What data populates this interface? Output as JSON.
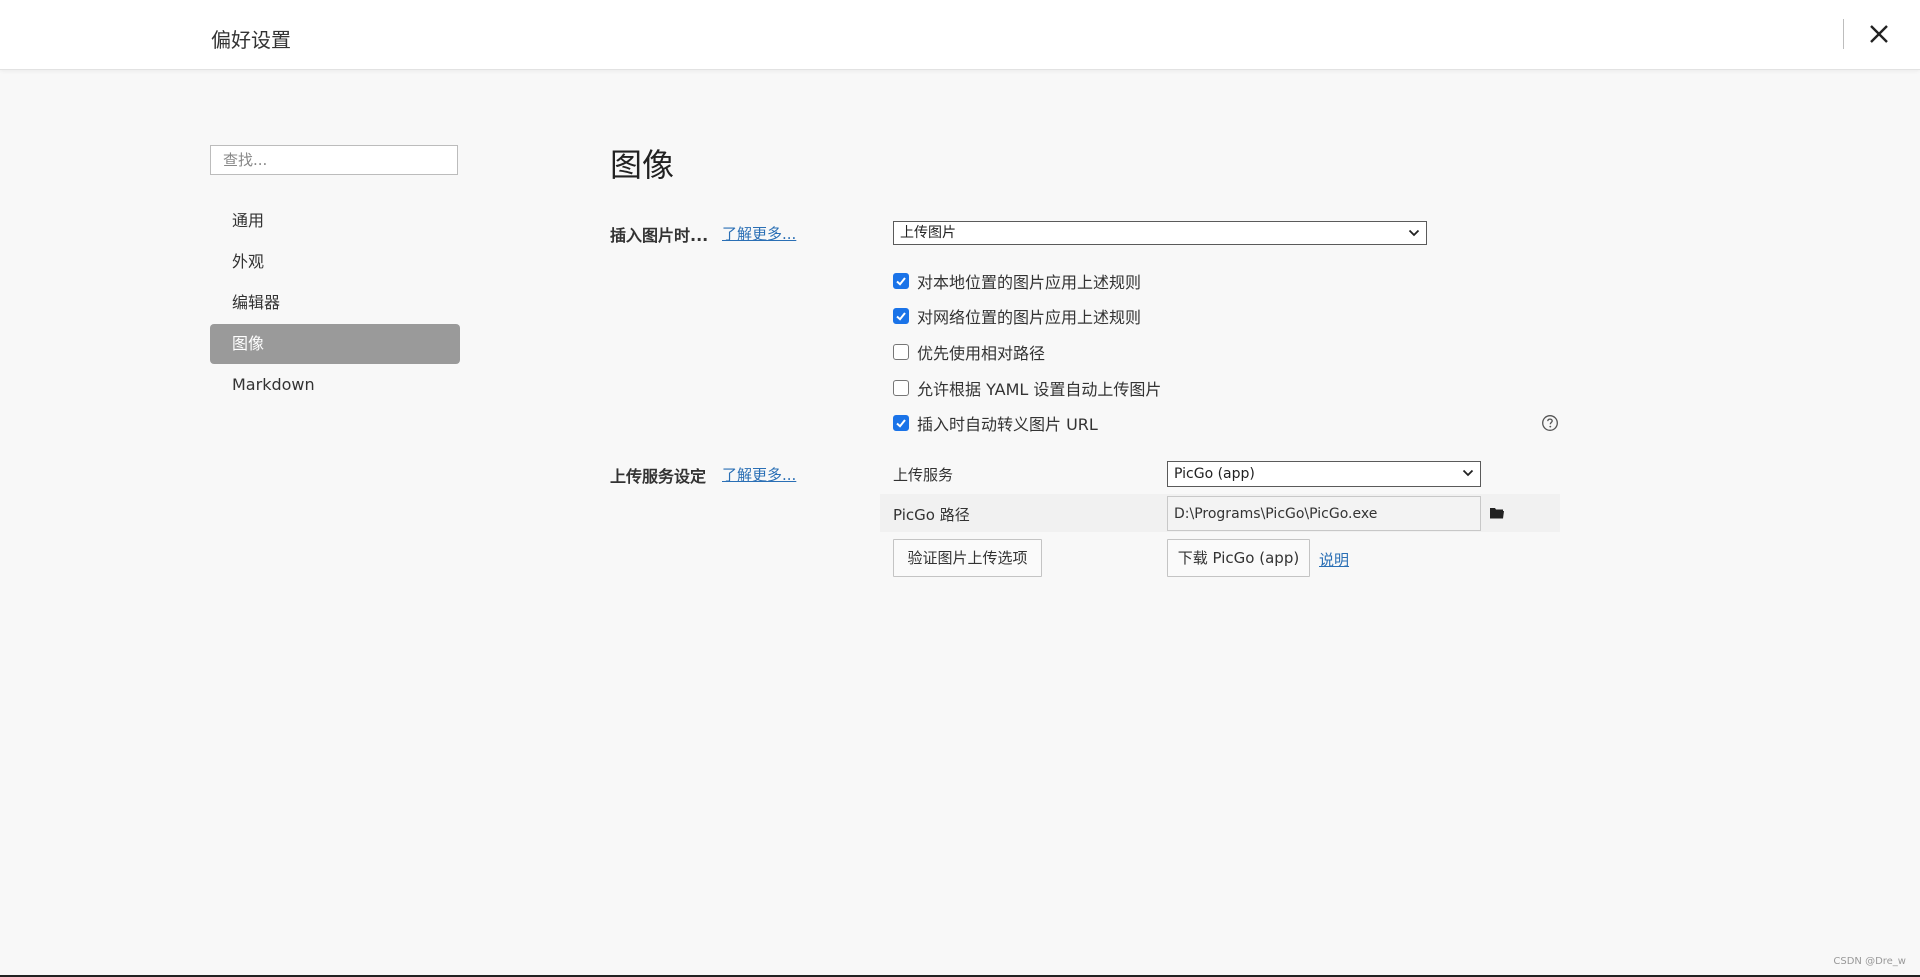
{
  "window": {
    "title": "偏好设置",
    "close_icon": "close-icon"
  },
  "sidebar": {
    "search_placeholder": "查找...",
    "items": [
      {
        "label": "通用"
      },
      {
        "label": "外观"
      },
      {
        "label": "编辑器"
      },
      {
        "label": "图像",
        "active": true
      },
      {
        "label": "Markdown"
      }
    ]
  },
  "main": {
    "title": "图像",
    "insert_image": {
      "label": "插入图片时...",
      "learn_more": "了解更多...",
      "selected_option": "上传图片"
    },
    "checkboxes": [
      {
        "label": "对本地位置的图片应用上述规则",
        "checked": true
      },
      {
        "label": "对网络位置的图片应用上述规则",
        "checked": true
      },
      {
        "label": "优先使用相对路径",
        "checked": false
      },
      {
        "label": "允许根据 YAML 设置自动上传图片",
        "checked": false
      },
      {
        "label": "插入时自动转义图片 URL",
        "checked": true
      }
    ],
    "help_icon": "help-circle-icon",
    "upload_service": {
      "label": "上传服务设定",
      "learn_more": "了解更多...",
      "service_label": "上传服务",
      "service_value": "PicGo (app)",
      "path_label": "PicGo 路径",
      "path_value": "D:\\Programs\\PicGo\\PicGo.exe",
      "folder_icon": "folder-icon",
      "verify_button": "验证图片上传选项",
      "download_button": "下载 PicGo (app)",
      "explain_link": "说明"
    }
  },
  "watermark": "CSDN @Dre_w",
  "colors": {
    "accent": "#1a73e8",
    "link": "#2a6fb5",
    "active_nav_bg": "#9a9a9a",
    "background": "#f8f8f8"
  }
}
